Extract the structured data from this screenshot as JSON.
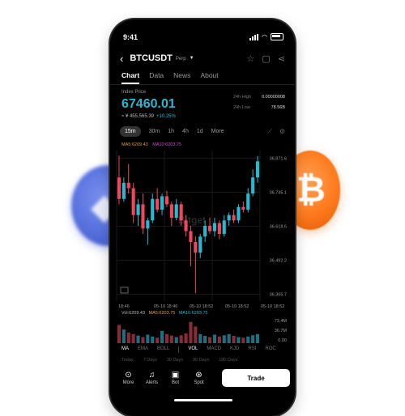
{
  "status": {
    "time": "9:41"
  },
  "header": {
    "pair": "BTCUSDT",
    "tag": "Perp"
  },
  "tabs": [
    "Chart",
    "Data",
    "News",
    "About"
  ],
  "index": {
    "label": "Index Price",
    "price": "67460.01",
    "sub": "≈ ¥ 455,565.39",
    "change": "+10.25%",
    "high_label": "24h High",
    "high": "0.00000008",
    "low_label": "24h Low",
    "low": "78.56B"
  },
  "timeframes": [
    "15m",
    "30m",
    "1h",
    "4h",
    "1d",
    "More"
  ],
  "ma": {
    "ma5": "MA5:6209.43",
    "ma10": "MA10:6203.75"
  },
  "axis": {
    "y": [
      "36,871.6",
      "36,745.1",
      "36,618.6",
      "36,492.2",
      "36,365.7"
    ],
    "x": [
      "18:46",
      "05-10 18:46",
      "05-10 18:52",
      "05-10 18:52",
      "05-10 18:52"
    ]
  },
  "watermark": "Bitget",
  "volume": {
    "vol": "Vol:6209.43",
    "ma5": "MA5:6203.75",
    "ma10": "MA10:6203.75",
    "y": [
      "73.4M",
      "36.7M",
      "0.00"
    ]
  },
  "indicators": [
    "MA",
    "EMA",
    "BOLL",
    "VOL",
    "MACD",
    "KJD",
    "RSI",
    "ROC"
  ],
  "ranges": [
    "Today",
    "7 Days",
    "30 Days",
    "90 Days",
    "180 Days"
  ],
  "bottom": {
    "items": [
      "More",
      "Alerts",
      "Bot",
      "Spot"
    ],
    "trade": "Trade"
  },
  "colors": {
    "up": "#28b8d0",
    "down": "#f0475c",
    "accent": "#28b8d0",
    "ma5": "#e0a33b",
    "ma10": "#d24bd8"
  },
  "chart_data": {
    "type": "candlestick",
    "y_axis_ticks": [
      "36,871.6",
      "36,745.1",
      "36,618.6",
      "36,492.2",
      "36,365.7"
    ],
    "x_axis_ticks": [
      "18:46",
      "05-10 18:46",
      "05-10 18:52",
      "05-10 18:52",
      "05-10 18:52"
    ],
    "candles": [
      {
        "o": 36800,
        "c": 36720,
        "h": 36880,
        "l": 36700
      },
      {
        "o": 36720,
        "c": 36780,
        "h": 36800,
        "l": 36710
      },
      {
        "o": 36780,
        "c": 36760,
        "h": 36850,
        "l": 36740
      },
      {
        "o": 36760,
        "c": 36660,
        "h": 36780,
        "l": 36630
      },
      {
        "o": 36660,
        "c": 36700,
        "h": 36720,
        "l": 36620
      },
      {
        "o": 36700,
        "c": 36610,
        "h": 36740,
        "l": 36590
      },
      {
        "o": 36610,
        "c": 36640,
        "h": 36650,
        "l": 36550
      },
      {
        "o": 36640,
        "c": 36720,
        "h": 36740,
        "l": 36630
      },
      {
        "o": 36720,
        "c": 36680,
        "h": 36760,
        "l": 36670
      },
      {
        "o": 36680,
        "c": 36730,
        "h": 36740,
        "l": 36660
      },
      {
        "o": 36730,
        "c": 36700,
        "h": 36750,
        "l": 36690
      },
      {
        "o": 36700,
        "c": 36650,
        "h": 36710,
        "l": 36620
      },
      {
        "o": 36650,
        "c": 36700,
        "h": 36720,
        "l": 36640
      },
      {
        "o": 36700,
        "c": 36640,
        "h": 36710,
        "l": 36620
      },
      {
        "o": 36640,
        "c": 36600,
        "h": 36660,
        "l": 36580
      },
      {
        "o": 36600,
        "c": 36560,
        "h": 36620,
        "l": 36470
      },
      {
        "o": 36560,
        "c": 36520,
        "h": 36580,
        "l": 36370
      },
      {
        "o": 36520,
        "c": 36580,
        "h": 36590,
        "l": 36500
      },
      {
        "o": 36580,
        "c": 36620,
        "h": 36640,
        "l": 36560
      },
      {
        "o": 36620,
        "c": 36600,
        "h": 36650,
        "l": 36590
      },
      {
        "o": 36600,
        "c": 36630,
        "h": 36650,
        "l": 36580
      },
      {
        "o": 36630,
        "c": 36590,
        "h": 36640,
        "l": 36570
      },
      {
        "o": 36590,
        "c": 36640,
        "h": 36660,
        "l": 36580
      },
      {
        "o": 36640,
        "c": 36660,
        "h": 36670,
        "l": 36620
      },
      {
        "o": 36660,
        "c": 36640,
        "h": 36680,
        "l": 36630
      },
      {
        "o": 36640,
        "c": 36690,
        "h": 36700,
        "l": 36630
      },
      {
        "o": 36690,
        "c": 36680,
        "h": 36710,
        "l": 36670
      },
      {
        "o": 36680,
        "c": 36740,
        "h": 36760,
        "l": 36670
      },
      {
        "o": 36740,
        "c": 36800,
        "h": 36830,
        "l": 36730
      },
      {
        "o": 36800,
        "c": 36860,
        "h": 36880,
        "l": 36780
      }
    ],
    "volume": [
      60,
      45,
      35,
      30,
      25,
      20,
      28,
      22,
      18,
      40,
      30,
      25,
      20,
      26,
      32,
      70,
      55,
      30,
      24,
      20,
      28,
      22,
      26,
      30,
      24,
      20,
      18,
      22,
      26,
      30
    ]
  }
}
